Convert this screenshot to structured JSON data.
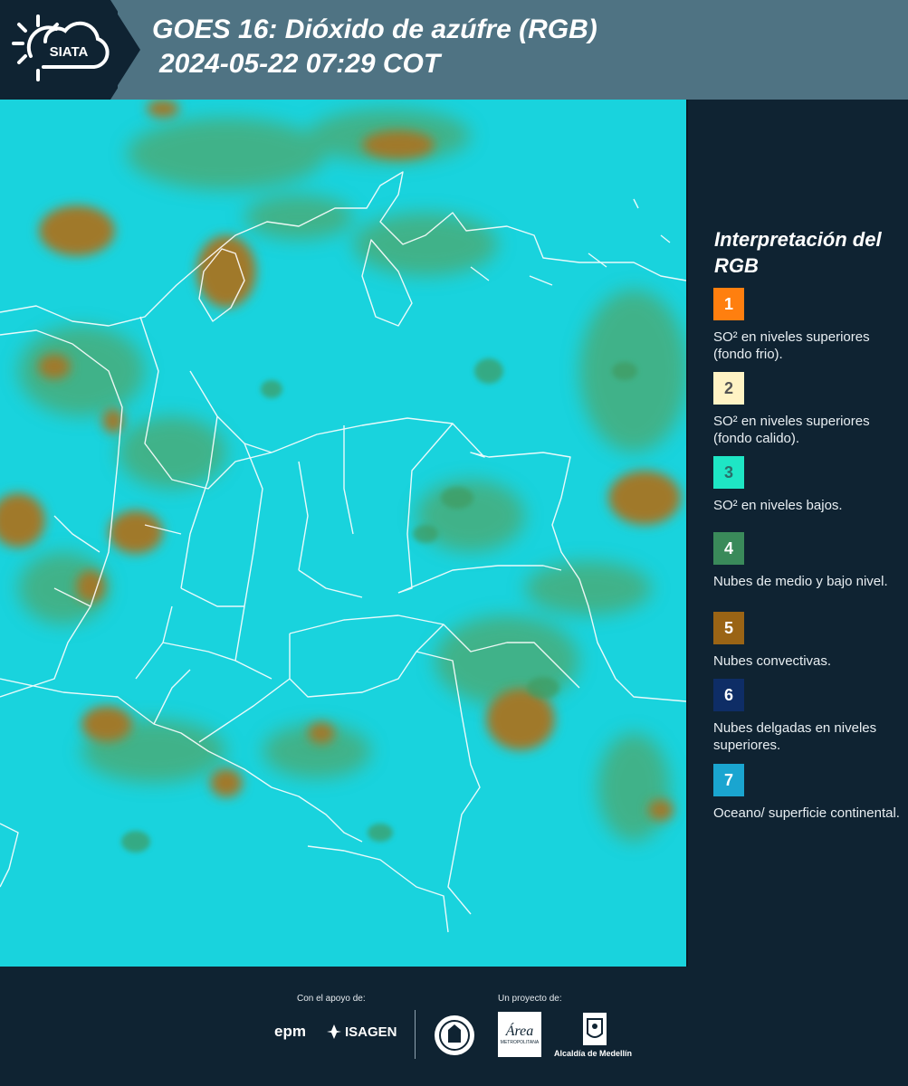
{
  "header": {
    "logo_text": "SIATA",
    "title": "GOES 16: Dióxido de azúfre (RGB)",
    "datetime": "2024-05-22 07:29 COT"
  },
  "map": {
    "base_color": "#19d3dd",
    "cloud_colors": {
      "convective": "#a0792b",
      "mid_low": "#3f9a5e",
      "mid": "#5fae7a"
    }
  },
  "legend": {
    "title": "Interpretación del RGB",
    "items": [
      {
        "number": "1",
        "color": "#ff7f0f",
        "number_color": "#ffffff",
        "label": "SO² en niveles superiores (fondo frio)."
      },
      {
        "number": "2",
        "color": "#fff3c4",
        "number_color": "#555555",
        "label": "SO² en niveles superiores (fondo calido)."
      },
      {
        "number": "3",
        "color": "#1ee6c5",
        "number_color": "#2a6e6a",
        "label": "SO² en niveles bajos."
      },
      {
        "number": "4",
        "color": "#3a8a5a",
        "number_color": "#ffffff",
        "label": "Nubes de medio y bajo nivel."
      },
      {
        "number": "5",
        "color": "#9a6415",
        "number_color": "#ffffff",
        "label": "Nubes convectivas."
      },
      {
        "number": "6",
        "color": "#0e2d66",
        "number_color": "#ffffff",
        "label": "Nubes delgadas en niveles superiores."
      },
      {
        "number": "7",
        "color": "#1aa5d0",
        "number_color": "#ffffff",
        "label": "Oceano/ superficie continental."
      }
    ]
  },
  "footer": {
    "support_label": "Con el apoyo de:",
    "project_label": "Un proyecto de:",
    "logos": {
      "epm": "epm",
      "isagen": "ISAGEN",
      "area": "Área",
      "area_sub": "METROPOLITANA",
      "medellin": "Alcaldía de Medellín"
    }
  }
}
